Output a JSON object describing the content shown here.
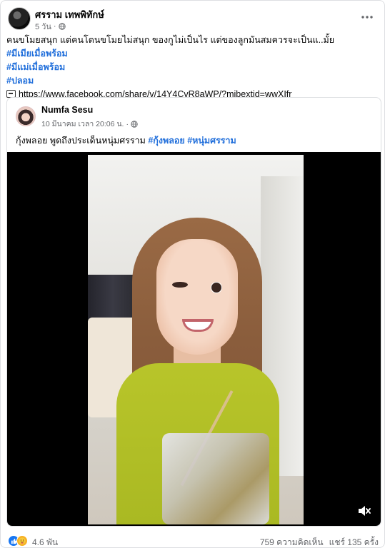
{
  "post": {
    "author": "ศรราม เทพพิทักษ์",
    "time": "5 วัน",
    "privacy_icon": "globe-icon",
    "more_icon": "more-horizontal-icon",
    "body_lines": [
      "คนขโมยสนุก แต่คนโดนขโมยไม่สนุก ของกูไม่เป็นไร แต่ของลูกมันสมควรจะเป็นแ..มั้ย"
    ],
    "hashtags": [
      "#มีเมียเมื่อพร้อม",
      "#มีแม่เมื่อพร้อม",
      "#ปลอม"
    ],
    "link_icon": "link-icon",
    "link_url": "https://www.facebook.com/share/v/14Y4CvR8aWP/?mibextid=wwXIfr"
  },
  "shared": {
    "author": "Numfa Sesu",
    "time": "10 มีนาคม เวลา 20:06 น.",
    "privacy_icon": "globe-icon",
    "text": "กุ้งพลอย พูดถึงประเด็นหนุ่มศรราม",
    "hashtags": [
      "#กุ้งพลอย",
      "#หนุ่มศรราม"
    ],
    "video_mute_icon": "speaker-muted-icon"
  },
  "footer": {
    "reaction_icons": [
      "like-icon",
      "care-icon"
    ],
    "reaction_count": "4.6 พัน",
    "comments": "759 ความคิดเห็น",
    "shares": "แชร์ 135 ครั้ง"
  },
  "colors": {
    "hashtag": "#216fdb",
    "meta": "#65676b",
    "like": "#1877f2"
  }
}
